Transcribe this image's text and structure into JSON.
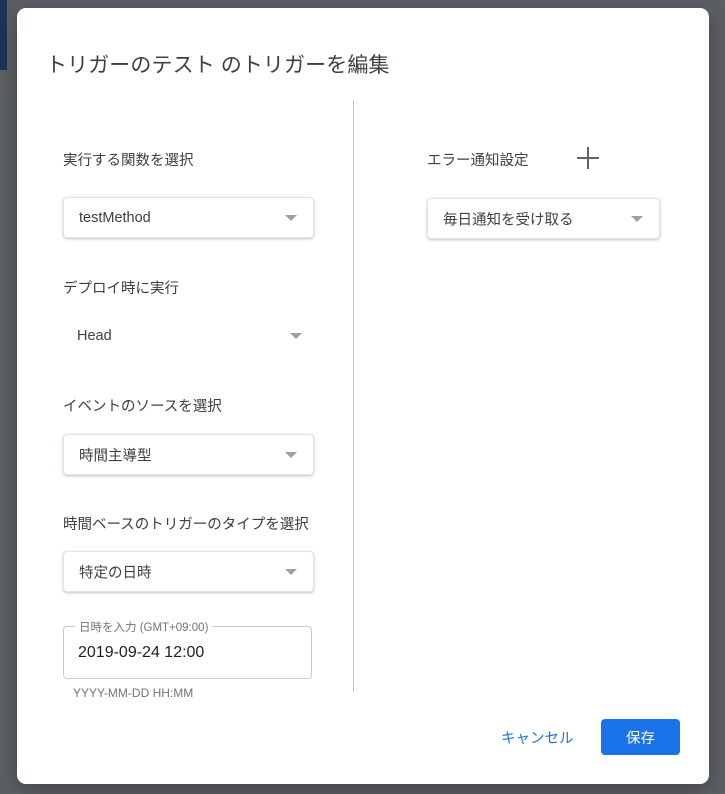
{
  "dialog": {
    "title": "トリガーのテスト のトリガーを編集"
  },
  "left_column": {
    "function_section": {
      "label": "実行する関数を選択",
      "selected": "testMethod"
    },
    "deployment_section": {
      "label": "デプロイ時に実行",
      "selected": "Head"
    },
    "event_source_section": {
      "label": "イベントのソースを選択",
      "selected": "時間主導型"
    },
    "time_trigger_type_section": {
      "label": "時間ベースのトリガーのタイプを選択",
      "selected": "特定の日時"
    },
    "datetime_field": {
      "label": "日時を入力 (GMT+09:00)",
      "value": "2019-09-24 12:00",
      "helper": "YYYY-MM-DD HH:MM"
    }
  },
  "right_column": {
    "error_notification_section": {
      "label": "エラー通知設定",
      "add_icon": "plus-icon",
      "selected": "毎日通知を受け取る"
    }
  },
  "footer": {
    "cancel_label": "キャンセル",
    "save_label": "保存"
  },
  "colors": {
    "accent": "#1a73e8",
    "backdrop": "#5c5f63",
    "text_primary": "#3c4043",
    "text_secondary": "#70757a",
    "edge_strip": "#1c3557"
  }
}
